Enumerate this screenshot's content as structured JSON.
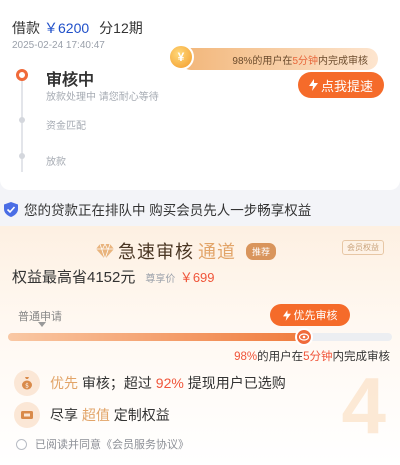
{
  "loan": {
    "label": "借款",
    "amount": "￥6200",
    "term": "分12期",
    "time": "2025-02-24 17:40:47"
  },
  "speed_up": {
    "tip_pre": "98%的用户在",
    "tip_highlight": "5分钟",
    "tip_post": "内完成审核",
    "button": "点我提速",
    "button_icon": "lightning-icon"
  },
  "steps": [
    {
      "title": "审核中",
      "desc": "放款处理中 请您耐心等待"
    },
    {
      "title": "资金匹配"
    },
    {
      "title": "放款"
    }
  ],
  "queue_notice": "您的贷款正在排队中 购买会员先人一步畅享权益",
  "member": {
    "title": "急速审核",
    "title_accent": "通道",
    "badge": "推荐",
    "tag": "会员权益",
    "save_text": "权益最高省4152元",
    "price_label": "尊享价",
    "price": "￥699",
    "normal_label": "普通申请",
    "priority_label": "优先审核",
    "progress_fraction": 0.77,
    "stat_pre": "98%",
    "stat_mid": "的用户在",
    "stat_hl": "5分钟",
    "stat_post": "内完成审核",
    "benefit1": {
      "a": "优先",
      "b": " 审核；超过 ",
      "c": "92%",
      "d": " 提现用户已选购"
    },
    "benefit2": {
      "a": "尽享 ",
      "b": "超值",
      "c": " 定制权益"
    },
    "agreement": "已阅读并同意《会员服务协议》"
  },
  "colors": {
    "accent": "#f56b2a",
    "gold": "#e2a468",
    "blue": "#1f4fc9"
  }
}
